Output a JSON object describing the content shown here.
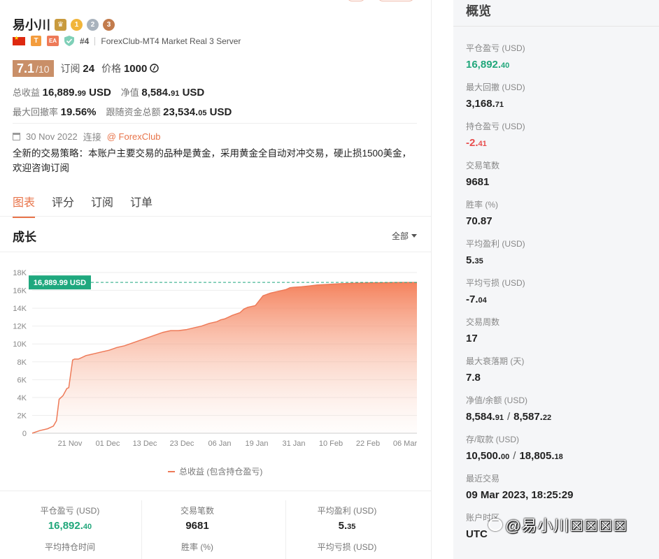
{
  "profile": {
    "name": "易小川",
    "rank": "#4",
    "server": "ForexClub-MT4 Market Real 3 Server",
    "badge_t": "T",
    "badge_ea": "EA",
    "medals": [
      "1",
      "2",
      "3"
    ],
    "rating": "7.1",
    "rating_max": "/10",
    "subscribe_label": "订阅",
    "subscribe_count": "24",
    "price_label": "价格",
    "price_value": "1000"
  },
  "metrics": {
    "total_profit_label": "总收益",
    "total_profit_int": "16,889.",
    "total_profit_dec": "99",
    "total_profit_unit": "USD",
    "equity_label": "净值",
    "equity_int": "8,584.",
    "equity_dec": "91",
    "equity_unit": "USD",
    "drawdown_label": "最大回撤率",
    "drawdown_value": "19.56%",
    "follow_label": "跟随资金总额",
    "follow_int": "23,534.",
    "follow_dec": "05",
    "follow_unit": "USD"
  },
  "since": {
    "date": "30 Nov 2022",
    "connect_label": "连接",
    "broker": "@ ForexClub"
  },
  "description": "全新的交易策略：本账户主要交易的品种是黄金，采用黄金全自动对冲交易，硬止损1500美金，欢迎咨询订阅",
  "tabs": [
    "图表",
    "评分",
    "订阅",
    "订单"
  ],
  "growth": {
    "title": "成长",
    "range_label": "全部"
  },
  "chart_data": {
    "type": "area",
    "ylim": [
      0,
      18000
    ],
    "yticks": [
      "0",
      "2K",
      "4K",
      "6K",
      "8K",
      "10K",
      "12K",
      "14K",
      "16K",
      "18K"
    ],
    "xticks": [
      "21 Nov",
      "01 Dec",
      "13 Dec",
      "23 Dec",
      "06 Jan",
      "19 Jan",
      "31 Jan",
      "10 Feb",
      "22 Feb",
      "06 Mar"
    ],
    "current_label": "16,889.99 USD",
    "current_value": 16889.99,
    "series": [
      {
        "name": "总收益 (包含持仓盈亏)",
        "x": [
          0,
          2,
          4,
          5.5,
          6.3,
          7,
          8,
          9,
          9.5,
          10.5,
          11,
          12,
          13,
          14,
          15,
          16,
          18,
          20,
          22,
          24,
          26,
          28,
          30,
          32,
          34,
          36,
          38,
          40,
          42,
          44,
          46,
          48,
          49,
          50,
          51,
          52,
          54,
          55,
          56,
          58,
          60,
          62,
          64,
          66,
          67,
          68,
          70,
          72,
          74,
          76,
          78,
          80,
          82,
          84,
          86,
          88,
          90,
          92,
          94,
          96,
          98,
          100
        ],
        "values": [
          0,
          300,
          500,
          800,
          1400,
          3800,
          4200,
          5000,
          5100,
          8200,
          8300,
          8300,
          8500,
          8700,
          8800,
          8900,
          9100,
          9300,
          9600,
          9800,
          10100,
          10400,
          10700,
          11000,
          11300,
          11500,
          11500,
          11600,
          11800,
          12000,
          12300,
          12500,
          12700,
          12800,
          13000,
          13200,
          13500,
          13900,
          14100,
          14300,
          15400,
          15700,
          15900,
          16100,
          16300,
          16350,
          16400,
          16500,
          16600,
          16650,
          16700,
          16750,
          16780,
          16800,
          16820,
          16840,
          16850,
          16860,
          16870,
          16880,
          16885,
          16890
        ]
      }
    ]
  },
  "bottom_stats": [
    {
      "label": "平仓盈亏 (USD)",
      "int": "16,892.",
      "dec": "40",
      "color": "#21a77b"
    },
    {
      "label": "交易笔数",
      "int": "9681",
      "dec": "",
      "color": "#222222"
    },
    {
      "label": "平均盈利 (USD)",
      "int": "5.",
      "dec": "35",
      "color": "#222222"
    },
    {
      "label": "平均持仓时间",
      "int": "",
      "dec": "",
      "color": "#222222"
    },
    {
      "label": "胜率 (%)",
      "int": "",
      "dec": "",
      "color": "#222222"
    },
    {
      "label": "平均亏损 (USD)",
      "int": "",
      "dec": "",
      "color": "#222222"
    }
  ],
  "overview": {
    "title": "概览",
    "items": [
      {
        "label": "平仓盈亏 (USD)",
        "int": "16,892.",
        "dec": "40",
        "color": "#21a77b"
      },
      {
        "label": "最大回撤 (USD)",
        "int": "3,168.",
        "dec": "71",
        "color": "#222222"
      },
      {
        "label": "持仓盈亏 (USD)",
        "int": "-2.",
        "dec": "41",
        "color": "#e84d4d"
      },
      {
        "label": "交易笔数",
        "int": "9681",
        "dec": "",
        "color": "#222222"
      },
      {
        "label": "胜率 (%)",
        "int": "70.87",
        "dec": "",
        "color": "#222222"
      },
      {
        "label": "平均盈利 (USD)",
        "int": "5.",
        "dec": "35",
        "color": "#222222"
      },
      {
        "label": "平均亏损 (USD)",
        "int": "-7.",
        "dec": "04",
        "color": "#222222"
      },
      {
        "label": "交易周数",
        "int": "17",
        "dec": "",
        "color": "#222222"
      },
      {
        "label": "最大衰落期 (天)",
        "int": "7.8",
        "dec": "",
        "color": "#222222"
      },
      {
        "label": "净值/余额 (USD)",
        "int": "8,584.",
        "dec": "91",
        "int2": "8,587.",
        "dec2": "22",
        "color": "#222222"
      },
      {
        "label": "存/取款 (USD)",
        "int": "10,500.",
        "dec": "00",
        "int2": "18,805.",
        "dec2": "18",
        "color": "#222222"
      },
      {
        "label": "最近交易",
        "int": "09 Mar 2023, 18:25:29",
        "dec": "",
        "color": "#222222"
      },
      {
        "label": "账户时区",
        "int": "UTC",
        "dec": "",
        "color": "#222222"
      }
    ]
  },
  "watermark": "@易小川☒☒☒☒"
}
